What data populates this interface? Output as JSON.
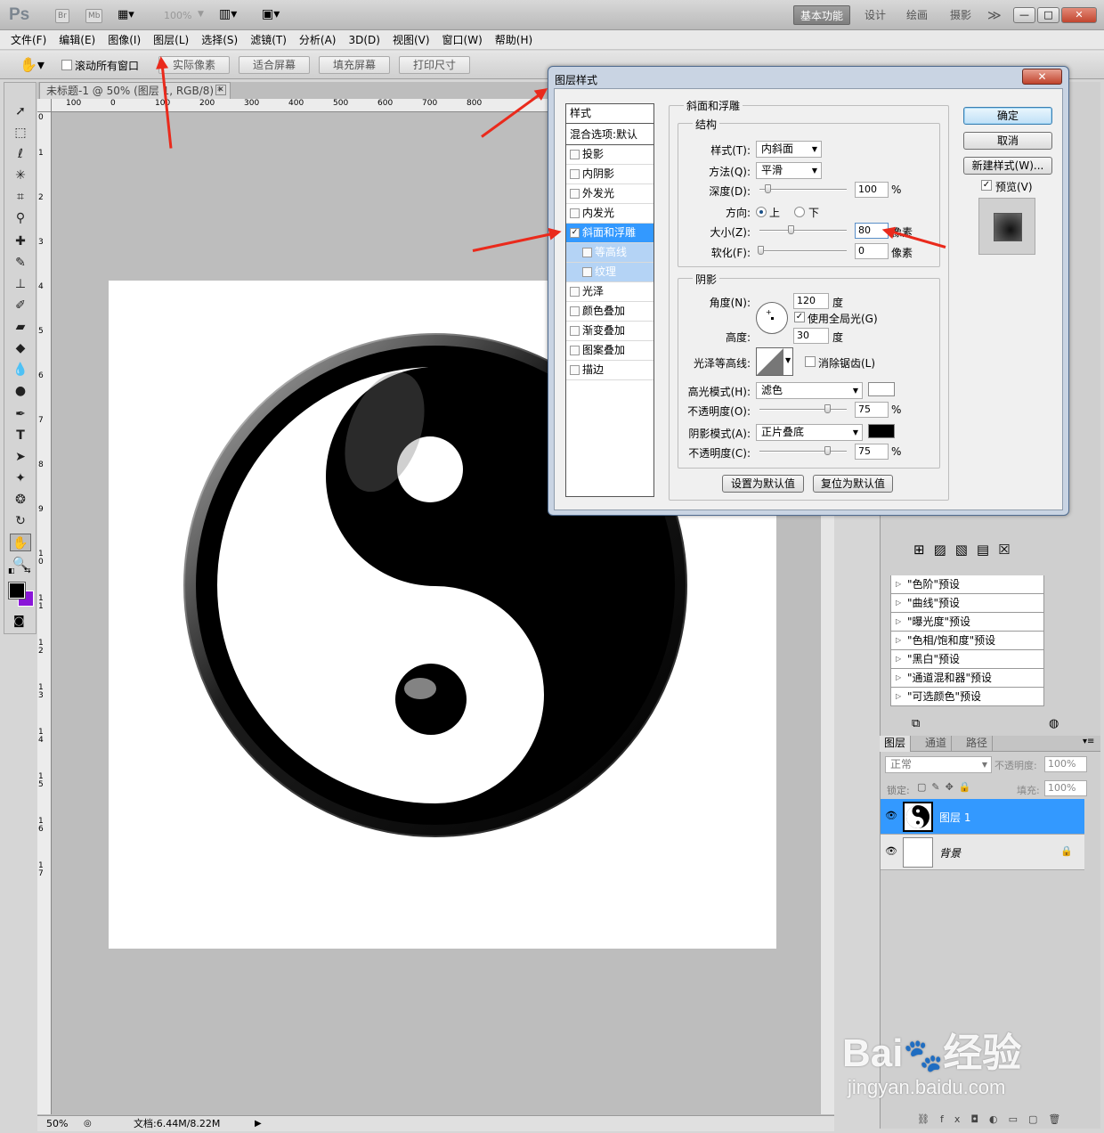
{
  "app": {
    "logo": "Ps",
    "bridge_label": "Br",
    "minibridge_label": "Mb",
    "zoom_display": "100%",
    "workspaces": [
      "基本功能",
      "设计",
      "绘画",
      "摄影"
    ],
    "workspace_more": "≫",
    "window_controls": [
      "—",
      "□",
      "✕"
    ]
  },
  "menu": [
    "文件(F)",
    "编辑(E)",
    "图像(I)",
    "图层(L)",
    "选择(S)",
    "滤镜(T)",
    "分析(A)",
    "3D(D)",
    "视图(V)",
    "窗口(W)",
    "帮助(H)"
  ],
  "options": {
    "scroll_all": "滚动所有窗口",
    "buttons": [
      "实际像素",
      "适合屏幕",
      "填充屏幕",
      "打印尺寸"
    ]
  },
  "document": {
    "tab_title": "未标题-1 @ 50% (图层 1, RGB/8) *",
    "ruler_h": [
      "100",
      "0",
      "100",
      "200",
      "300",
      "400",
      "500",
      "600",
      "700",
      "800"
    ],
    "ruler_v": [
      "0",
      "1",
      "2",
      "3",
      "4",
      "5",
      "6",
      "7",
      "8",
      "9",
      "10",
      "11",
      "12",
      "13",
      "14",
      "15",
      "16",
      "17"
    ],
    "status_zoom": "50%",
    "status_doc": "文档:6.44M/8.22M"
  },
  "dialog": {
    "title": "图层样式",
    "close": "✕",
    "styles_header": "样式",
    "blend_options": "混合选项:默认",
    "styles": [
      {
        "label": "投影",
        "checked": false
      },
      {
        "label": "内阴影",
        "checked": false
      },
      {
        "label": "外发光",
        "checked": false
      },
      {
        "label": "内发光",
        "checked": false
      },
      {
        "label": "斜面和浮雕",
        "checked": true
      },
      {
        "label": "等高线",
        "checked": false
      },
      {
        "label": "纹理",
        "checked": false
      },
      {
        "label": "光泽",
        "checked": false
      },
      {
        "label": "颜色叠加",
        "checked": false
      },
      {
        "label": "渐变叠加",
        "checked": false
      },
      {
        "label": "图案叠加",
        "checked": false
      },
      {
        "label": "描边",
        "checked": false
      }
    ],
    "bevel": {
      "section_title": "斜面和浮雕",
      "structure_title": "结构",
      "style_label": "样式(T):",
      "style_value": "内斜面",
      "technique_label": "方法(Q):",
      "technique_value": "平滑",
      "depth_label": "深度(D):",
      "depth_value": "100",
      "depth_unit": "%",
      "direction_label": "方向:",
      "direction_up": "上",
      "direction_down": "下",
      "size_label": "大小(Z):",
      "size_value": "80",
      "size_unit": "像素",
      "soften_label": "软化(F):",
      "soften_value": "0",
      "soften_unit": "像素"
    },
    "shading": {
      "title": "阴影",
      "angle_label": "角度(N):",
      "angle_value": "120",
      "angle_unit": "度",
      "global_light": "使用全局光(G)",
      "altitude_label": "高度:",
      "altitude_value": "30",
      "altitude_unit": "度",
      "gloss_label": "光泽等高线:",
      "antialias": "消除锯齿(L)",
      "highlight_label": "高光模式(H):",
      "highlight_value": "滤色",
      "highlight_opacity_label": "不透明度(O):",
      "highlight_opacity": "75",
      "shadow_label": "阴影模式(A):",
      "shadow_value": "正片叠底",
      "shadow_opacity_label": "不透明度(C):",
      "shadow_opacity": "75",
      "pct": "%"
    },
    "buttons": {
      "ok": "确定",
      "cancel": "取消",
      "new_style": "新建样式(W)...",
      "preview": "预览(V)",
      "make_default": "设置为默认值",
      "reset_default": "复位为默认值"
    }
  },
  "adjust_presets": [
    "\"色阶\"预设",
    "\"曲线\"预设",
    "\"曝光度\"预设",
    "\"色相/饱和度\"预设",
    "\"黑白\"预设",
    "\"通道混和器\"预设",
    "\"可选颜色\"预设"
  ],
  "layers": {
    "tabs": [
      "图层",
      "通道",
      "路径"
    ],
    "blend_mode": "正常",
    "opacity_label": "不透明度:",
    "opacity": "100%",
    "lock_label": "锁定:",
    "fill_label": "填充:",
    "fill": "100%",
    "items": [
      {
        "name": "图层 1",
        "selected": true
      },
      {
        "name": "背景",
        "selected": false
      }
    ]
  },
  "watermark": {
    "brand": "Bai",
    "brand_cn": "经验",
    "url": "jingyan.baidu.com"
  },
  "colors": {
    "selection": "#3399ff",
    "arrow": "#ea2a1c",
    "foreground": "#000000",
    "background": "#8a16d8"
  }
}
